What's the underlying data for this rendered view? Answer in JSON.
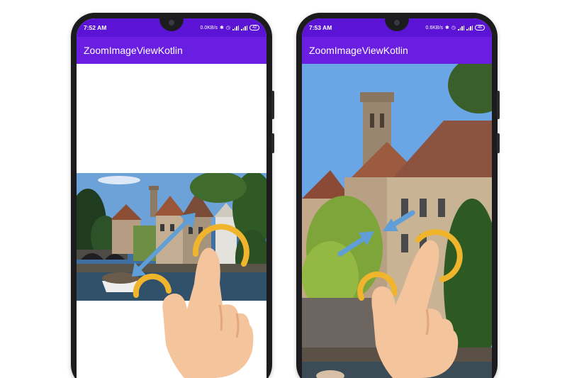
{
  "phones": [
    {
      "status": {
        "time": "7:52 AM",
        "net_speed": "0.0KB/s",
        "battery": "42"
      },
      "app_title": "ZoomImageViewKotlin",
      "gesture": "pinch-zoom-in"
    },
    {
      "status": {
        "time": "7:53 AM",
        "net_speed": "0.6KB/s",
        "battery": "46"
      },
      "app_title": "ZoomImageViewKotlin",
      "gesture": "pinch-zoom-out"
    }
  ],
  "colors": {
    "status_bar": "#5b14d6",
    "app_bar": "#6a1ee2",
    "gesture_arc": "#f0b52d",
    "gesture_arrow": "#5f9ed6",
    "hand": "#f4c49c"
  }
}
